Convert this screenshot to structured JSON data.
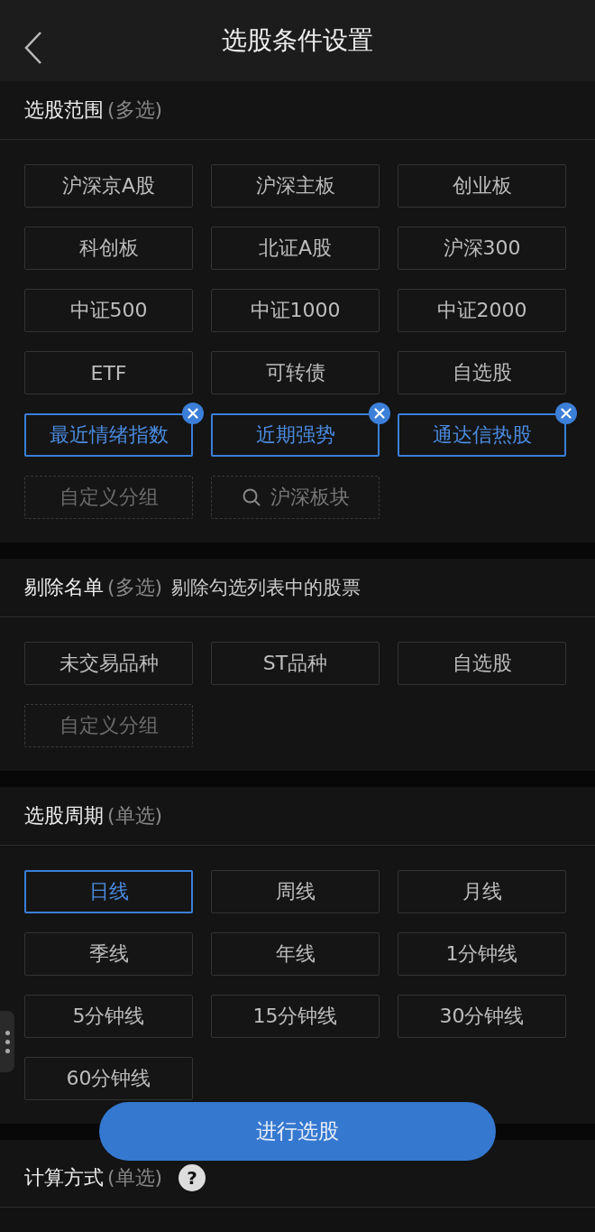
{
  "header": {
    "title": "选股条件设置"
  },
  "sections": [
    {
      "title": "选股范围",
      "hint": "(多选)",
      "chips": [
        {
          "label": "沪深京A股",
          "kind": "option",
          "selected": false,
          "removable": false
        },
        {
          "label": "沪深主板",
          "kind": "option",
          "selected": false,
          "removable": false
        },
        {
          "label": "创业板",
          "kind": "option",
          "selected": false,
          "removable": false
        },
        {
          "label": "科创板",
          "kind": "option",
          "selected": false,
          "removable": false
        },
        {
          "label": "北证A股",
          "kind": "option",
          "selected": false,
          "removable": false
        },
        {
          "label": "沪深300",
          "kind": "option",
          "selected": false,
          "removable": false
        },
        {
          "label": "中证500",
          "kind": "option",
          "selected": false,
          "removable": false
        },
        {
          "label": "中证1000",
          "kind": "option",
          "selected": false,
          "removable": false
        },
        {
          "label": "中证2000",
          "kind": "option",
          "selected": false,
          "removable": false
        },
        {
          "label": "ETF",
          "kind": "option",
          "selected": false,
          "removable": false
        },
        {
          "label": "可转债",
          "kind": "option",
          "selected": false,
          "removable": false
        },
        {
          "label": "自选股",
          "kind": "option",
          "selected": false,
          "removable": false
        },
        {
          "label": "最近情绪指数",
          "kind": "option",
          "selected": true,
          "removable": true
        },
        {
          "label": "近期强势",
          "kind": "option",
          "selected": true,
          "removable": true
        },
        {
          "label": "通达信热股",
          "kind": "option",
          "selected": true,
          "removable": true
        },
        {
          "label": "自定义分组",
          "kind": "add"
        },
        {
          "label": "沪深板块",
          "kind": "search"
        }
      ]
    },
    {
      "title": "剔除名单",
      "hint": "(多选)",
      "note": "剔除勾选列表中的股票",
      "chips": [
        {
          "label": "未交易品种",
          "kind": "option",
          "selected": false,
          "removable": false
        },
        {
          "label": "ST品种",
          "kind": "option",
          "selected": false,
          "removable": false
        },
        {
          "label": "自选股",
          "kind": "option",
          "selected": false,
          "removable": false
        },
        {
          "label": "自定义分组",
          "kind": "add"
        }
      ]
    },
    {
      "title": "选股周期",
      "hint": "(单选)",
      "chips": [
        {
          "label": "日线",
          "kind": "option",
          "selected": true,
          "removable": false
        },
        {
          "label": "周线",
          "kind": "option",
          "selected": false,
          "removable": false
        },
        {
          "label": "月线",
          "kind": "option",
          "selected": false,
          "removable": false
        },
        {
          "label": "季线",
          "kind": "option",
          "selected": false,
          "removable": false
        },
        {
          "label": "年线",
          "kind": "option",
          "selected": false,
          "removable": false
        },
        {
          "label": "1分钟线",
          "kind": "option",
          "selected": false,
          "removable": false
        },
        {
          "label": "5分钟线",
          "kind": "option",
          "selected": false,
          "removable": false
        },
        {
          "label": "15分钟线",
          "kind": "option",
          "selected": false,
          "removable": false
        },
        {
          "label": "30分钟线",
          "kind": "option",
          "selected": false,
          "removable": false
        },
        {
          "label": "60分钟线",
          "kind": "option",
          "selected": false,
          "removable": false
        }
      ]
    },
    {
      "title": "计算方式",
      "hint": "(单选)",
      "help": "?"
    }
  ],
  "action_button": {
    "label": "进行选股"
  }
}
